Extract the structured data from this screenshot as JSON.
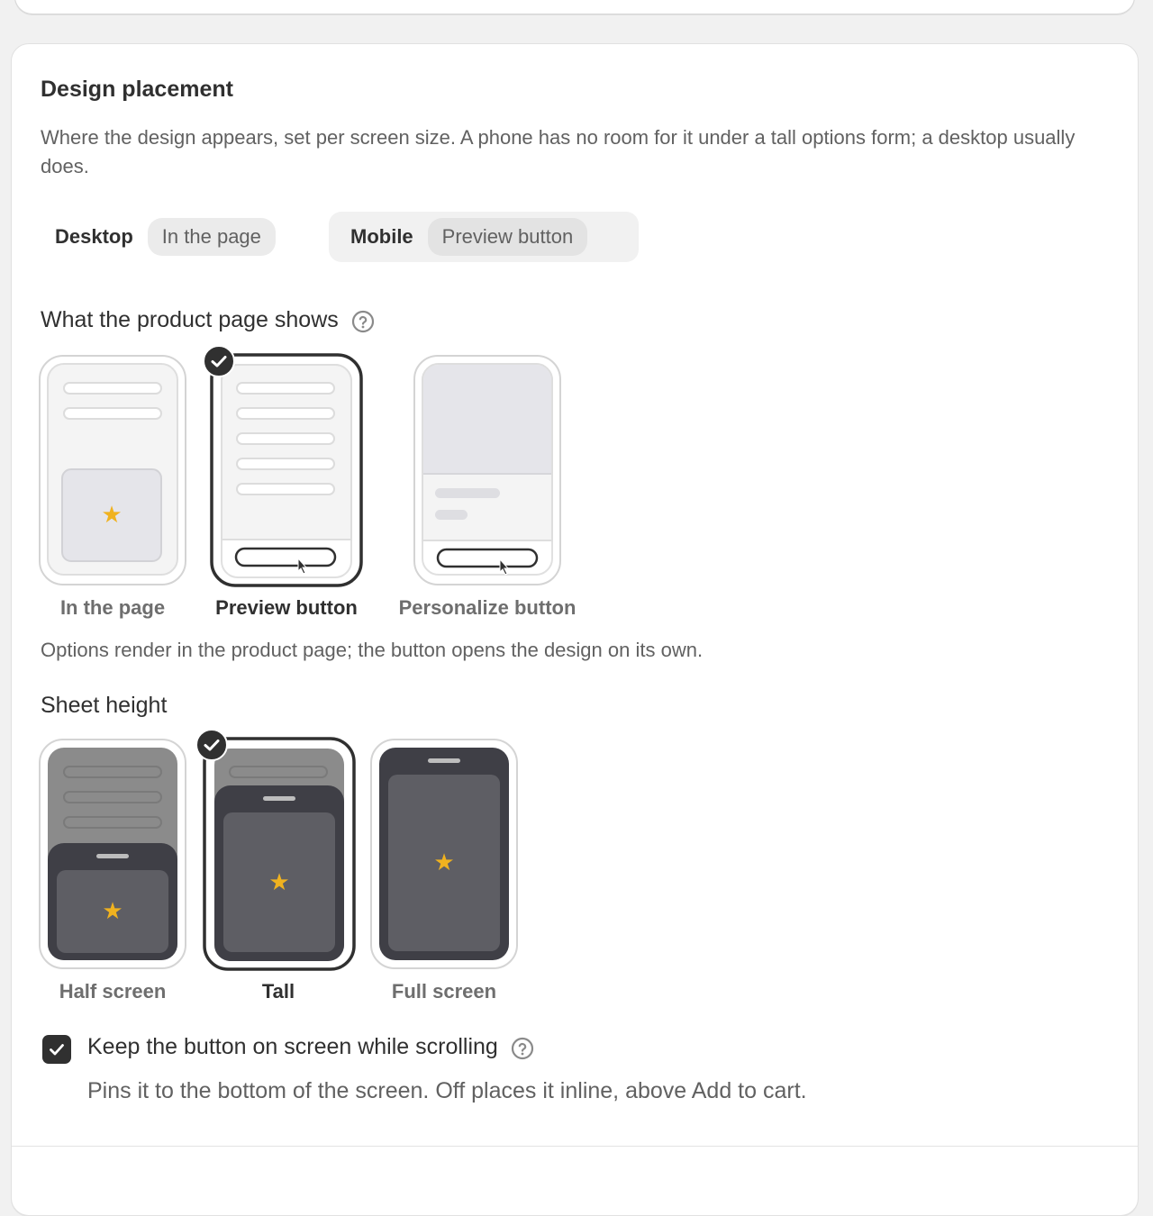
{
  "section": {
    "title": "Design placement",
    "description": "Where the design appears, set per screen size. A phone has no room for it under a tall options form; a desktop usually does."
  },
  "devices": [
    {
      "label": "Desktop",
      "value": "In the page",
      "selected": false
    },
    {
      "label": "Mobile",
      "value": "Preview button",
      "selected": true
    }
  ],
  "product_page": {
    "heading": "What the product page shows",
    "options": [
      {
        "label": "In the page",
        "selected": false
      },
      {
        "label": "Preview button",
        "selected": true
      },
      {
        "label": "Personalize button",
        "selected": false
      }
    ],
    "note": "Options render in the product page; the button opens the design on its own."
  },
  "sheet_height": {
    "heading": "Sheet height",
    "options": [
      {
        "label": "Half screen",
        "selected": false
      },
      {
        "label": "Tall",
        "selected": true
      },
      {
        "label": "Full screen",
        "selected": false
      }
    ]
  },
  "sticky": {
    "label": "Keep the button on screen while scrolling",
    "help": "Pins it to the bottom of the screen. Off places it inline, above Add to cart.",
    "checked": true
  },
  "colors": {
    "accent_star": "#f0b21f",
    "selected_border": "#303030",
    "sheet_dark": "#3f3f46",
    "sheet_inner": "#5e5e64"
  },
  "icons": {
    "help": "question-circle-icon",
    "check": "checkmark-icon",
    "star": "star-icon",
    "cursor": "pointer-cursor-icon"
  }
}
